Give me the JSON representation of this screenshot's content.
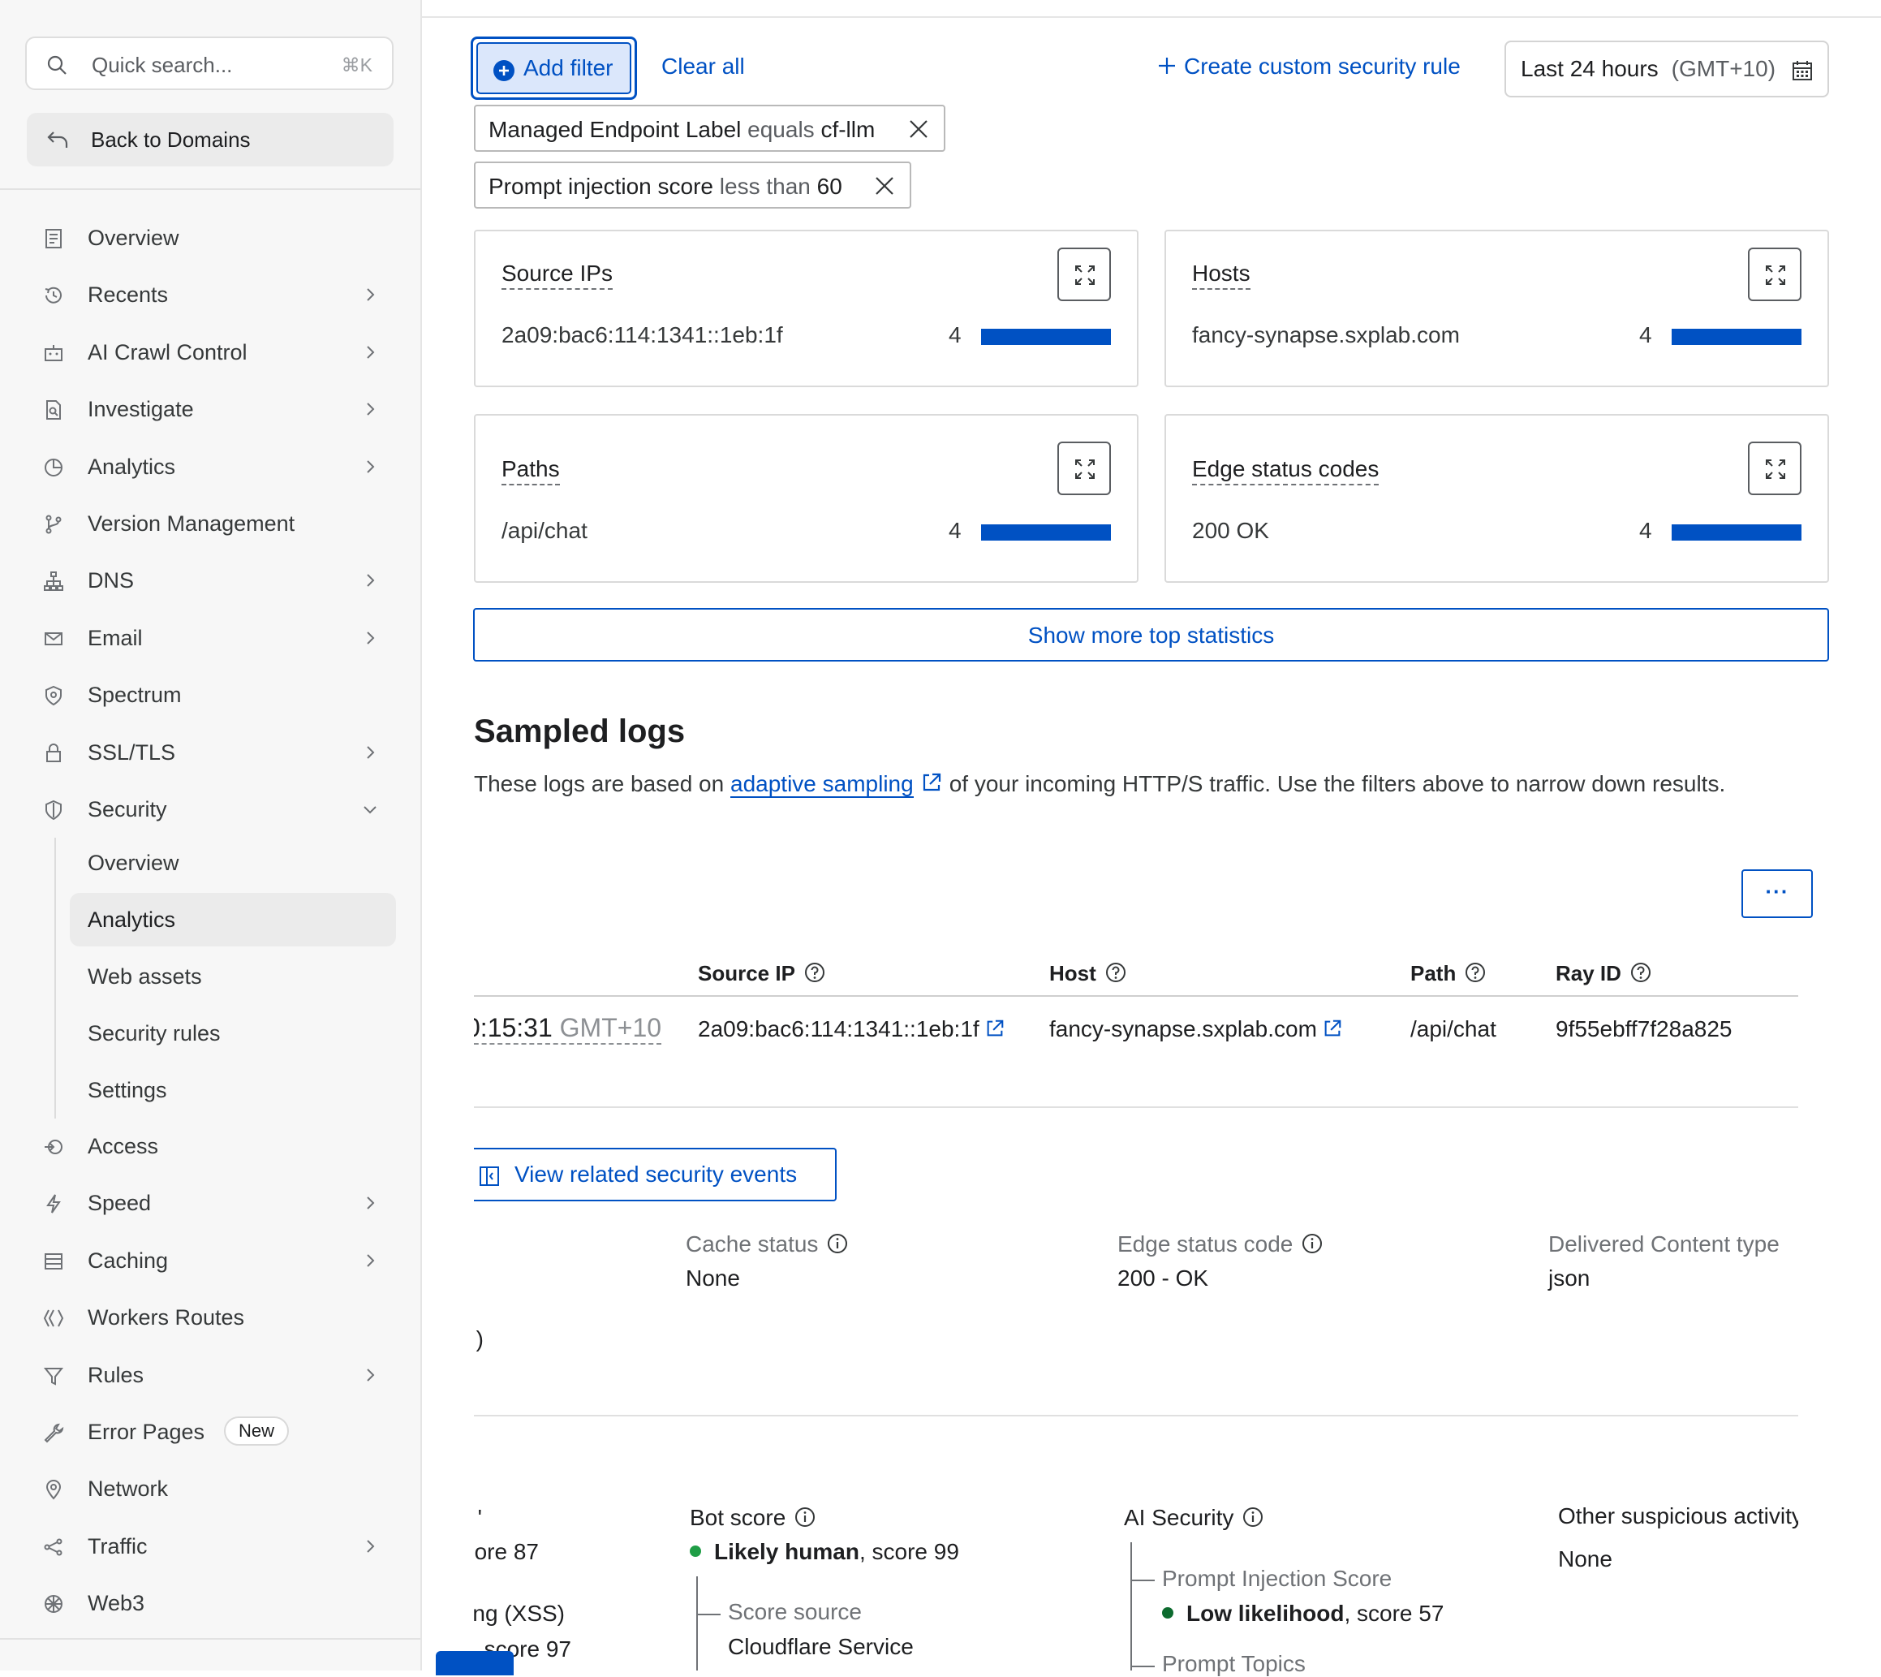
{
  "sidebar": {
    "search_placeholder": "Quick search...",
    "search_shortcut": "⌘K",
    "back_label": "Back to Domains",
    "items": [
      {
        "label": "Overview",
        "icon": "document-icon",
        "chevron": false
      },
      {
        "label": "Recents",
        "icon": "history-icon",
        "chevron": true
      },
      {
        "label": "AI Crawl Control",
        "icon": "robot-icon",
        "chevron": true
      },
      {
        "label": "Investigate",
        "icon": "file-search-icon",
        "chevron": true
      },
      {
        "label": "Analytics",
        "icon": "pie-chart-icon",
        "chevron": true
      },
      {
        "label": "Version Management",
        "icon": "branch-icon",
        "chevron": false
      },
      {
        "label": "DNS",
        "icon": "hierarchy-icon",
        "chevron": true
      },
      {
        "label": "Email",
        "icon": "mail-icon",
        "chevron": true
      },
      {
        "label": "Spectrum",
        "icon": "shield-badge-icon",
        "chevron": false
      },
      {
        "label": "SSL/TLS",
        "icon": "lock-icon",
        "chevron": true
      },
      {
        "label": "Security",
        "icon": "shield-icon",
        "chevron": "down"
      }
    ],
    "security_subitems": [
      {
        "label": "Overview",
        "active": false
      },
      {
        "label": "Analytics",
        "active": true
      },
      {
        "label": "Web assets",
        "active": false
      },
      {
        "label": "Security rules",
        "active": false
      },
      {
        "label": "Settings",
        "active": false
      }
    ],
    "items_after": [
      {
        "label": "Access",
        "icon": "access-icon",
        "chevron": false
      },
      {
        "label": "Speed",
        "icon": "lightning-icon",
        "chevron": true
      },
      {
        "label": "Caching",
        "icon": "storage-icon",
        "chevron": true
      },
      {
        "label": "Workers Routes",
        "icon": "workers-icon",
        "chevron": false
      },
      {
        "label": "Rules",
        "icon": "funnel-icon",
        "chevron": true
      },
      {
        "label": "Error Pages",
        "icon": "wrench-icon",
        "chevron": false,
        "badge": "New"
      },
      {
        "label": "Network",
        "icon": "location-pin-icon",
        "chevron": false
      },
      {
        "label": "Traffic",
        "icon": "share-icon",
        "chevron": true
      },
      {
        "label": "Web3",
        "icon": "web3-icon",
        "chevron": false
      }
    ]
  },
  "toolbar": {
    "add_filter": "Add filter",
    "clear_all": "Clear all",
    "create_rule": "Create custom security rule",
    "date_range": "Last 24 hours",
    "timezone": "(GMT+10)"
  },
  "filters": [
    {
      "field": "Managed Endpoint Label",
      "op": "equals",
      "value": "cf-llm"
    },
    {
      "field": "Prompt injection score",
      "op": "less than",
      "value": "60"
    }
  ],
  "stats": [
    {
      "title": "Source IPs",
      "key": "2a09:bac6:114:1341::1eb:1f",
      "count": "4",
      "share": 1.0
    },
    {
      "title": "Hosts",
      "key": "fancy-synapse.sxplab.com",
      "count": "4",
      "share": 1.0
    },
    {
      "title": "Paths",
      "key": "/api/chat",
      "count": "4",
      "share": 1.0
    },
    {
      "title": "Edge status codes",
      "key": "200 OK",
      "count": "4",
      "share": 1.0
    }
  ],
  "show_more": "Show more top statistics",
  "logs": {
    "title": "Sampled logs",
    "desc_prefix": "These logs are based on",
    "desc_link": "adaptive sampling",
    "desc_suffix": "of your incoming HTTP/S traffic. Use the filters above to narrow down results.",
    "more_label": "···",
    "columns": {
      "source_ip": "Source IP",
      "host": "Host",
      "path": "Path",
      "ray_id": "Ray ID"
    },
    "row": {
      "time": "0:15:31",
      "time_tz": "GMT+10",
      "source_ip": "2a09:bac6:114:1341::1eb:1f",
      "host": "fancy-synapse.sxplab.com",
      "path": "/api/chat",
      "ray_id": "9f55ebff7f28a825"
    },
    "related_events": "View related security events",
    "details": {
      "cache_status_label": "Cache status",
      "cache_status": "None",
      "edge_status_label": "Edge status code",
      "edge_status": "200 - OK",
      "content_type_label": "Delivered Content type",
      "content_type": "json",
      "clipped_left": ")"
    },
    "scores": {
      "left_clip_1": "'",
      "left_clip_2": "ore 87",
      "left_clip_3": "ng (XSS)",
      "left_clip_4": "score 97",
      "bot_label": "Bot score",
      "bot_verdict": "Likely human",
      "bot_score": ", score 99",
      "bot_source_label": "Score source",
      "bot_source": "Cloudflare Service",
      "ai_label": "AI Security",
      "pi_label": "Prompt Injection Score",
      "pi_verdict": "Low likelihood",
      "pi_score": ", score 57",
      "topics_label": "Prompt Topics",
      "other_label": "Other suspicious activity",
      "other_value": "None"
    }
  },
  "colors": {
    "accent": "#0051c3",
    "green": "#1f9d46",
    "dark_green": "#0d6b2f"
  }
}
